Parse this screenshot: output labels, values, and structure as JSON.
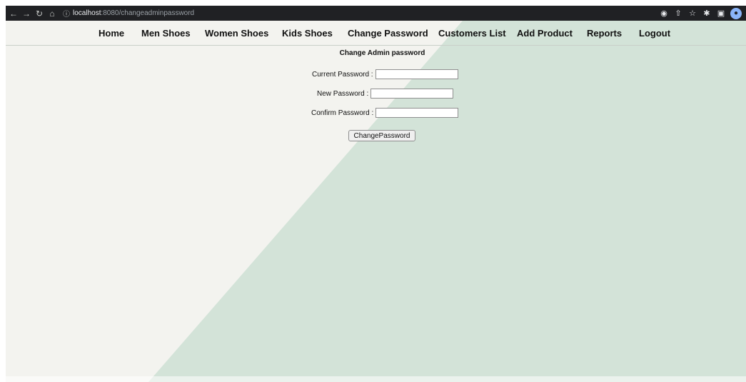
{
  "browser": {
    "url_host": "localhost",
    "url_path": ":8080/changeadminpassword"
  },
  "nav": {
    "items": [
      {
        "label": "Home"
      },
      {
        "label": "Men Shoes"
      },
      {
        "label": "Women Shoes"
      },
      {
        "label": "Kids Shoes"
      },
      {
        "label": "Change Password"
      },
      {
        "label": "Customers List"
      },
      {
        "label": "Add Product"
      },
      {
        "label": "Reports"
      },
      {
        "label": "Logout"
      }
    ]
  },
  "form": {
    "title": "Change Admin password",
    "current_label": "Current Password :",
    "current_value": "",
    "new_label": "New Password :",
    "new_value": "",
    "confirm_label": "Confirm Password :",
    "confirm_value": "",
    "submit_label": "ChangePassword"
  },
  "colors": {
    "page_light": "#f3f3ef",
    "page_green": "#d3e3d8",
    "chrome_bar": "#202124"
  },
  "icons": {
    "back": "arrow-left-icon",
    "forward": "arrow-right-icon",
    "reload": "reload-icon",
    "home": "home-icon",
    "site_info": "info-icon",
    "google_lens": "lens-icon",
    "share": "share-icon",
    "bookmark": "star-icon",
    "extensions": "puzzle-icon",
    "side_panel": "side-panel-icon",
    "profile": "avatar-icon"
  }
}
